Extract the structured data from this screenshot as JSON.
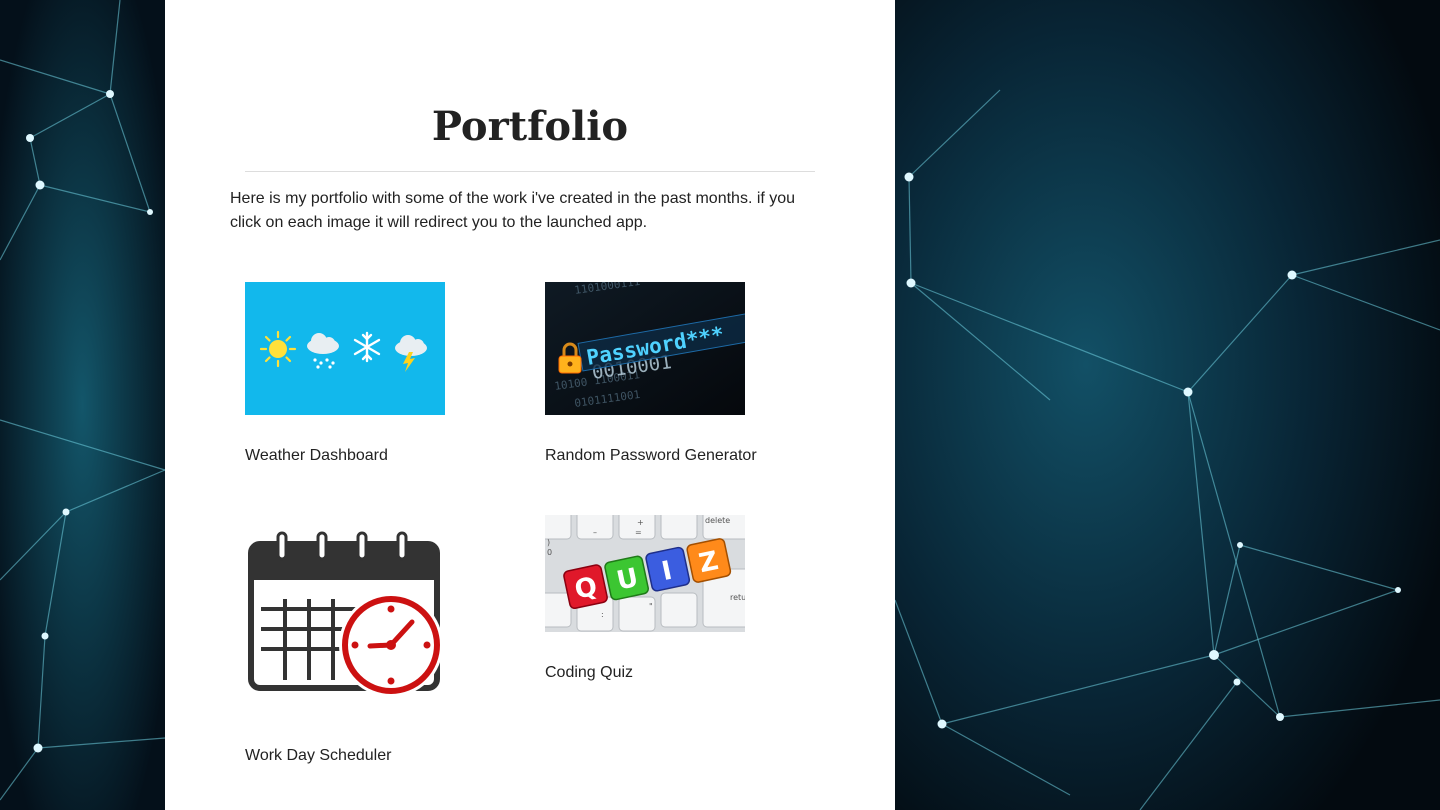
{
  "page": {
    "title": "Portfolio",
    "intro": "Here is my portfolio with some of the work i've created in the past months. if you click on each image it will redirect you to the launched app."
  },
  "projects": [
    {
      "name": "Weather Dashboard",
      "icon": "weather-icons-image"
    },
    {
      "name": "Random Password Generator",
      "icon": "password-padlock-image",
      "image_text": "Password***"
    },
    {
      "name": "Work Day Scheduler",
      "icon": "calendar-clock-image"
    },
    {
      "name": "Coding Quiz",
      "icon": "quiz-keyboard-image",
      "image_text": [
        "Q",
        "U",
        "I",
        "Z"
      ]
    }
  ],
  "colors": {
    "panel": "#ffffff",
    "text": "#222222",
    "background": "#06141c",
    "network_lines": "#59c8d8",
    "weather_bg": "#12b8ec",
    "calendar_dark": "#333333",
    "clock_red": "#cc1111"
  }
}
